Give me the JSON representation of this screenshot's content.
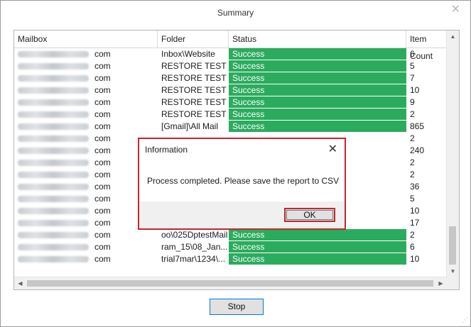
{
  "window": {
    "title": "Summary",
    "close_glyph": "✕",
    "size_grip": "⋰"
  },
  "table": {
    "columns": [
      "Mailbox",
      "Folder",
      "Status",
      "Item Count"
    ],
    "rows": [
      {
        "mailbox": "com",
        "folder": "Inbox\\Website",
        "status": "Success",
        "count": "6"
      },
      {
        "mailbox": "com",
        "folder": "RESTORE TEST ...",
        "status": "Success",
        "count": "5"
      },
      {
        "mailbox": "com",
        "folder": "RESTORE TEST ...",
        "status": "Success",
        "count": "7"
      },
      {
        "mailbox": "com",
        "folder": "RESTORE TEST ...",
        "status": "Success",
        "count": "10"
      },
      {
        "mailbox": "com",
        "folder": "RESTORE TEST ...",
        "status": "Success",
        "count": "9"
      },
      {
        "mailbox": "com",
        "folder": "RESTORE TEST ...",
        "status": "Success",
        "count": "2"
      },
      {
        "mailbox": "com",
        "folder": "[Gmail]\\All Mail",
        "status": "Success",
        "count": "865"
      },
      {
        "mailbox": "com",
        "folder": "",
        "status": "",
        "count": "2"
      },
      {
        "mailbox": "com",
        "folder": "",
        "status": "",
        "count": "240"
      },
      {
        "mailbox": "com",
        "folder": "",
        "status": "",
        "count": "2"
      },
      {
        "mailbox": "com",
        "folder": "",
        "status": "",
        "count": "2"
      },
      {
        "mailbox": "com",
        "folder": "",
        "status": "",
        "count": "36"
      },
      {
        "mailbox": "com",
        "folder": "",
        "status": "",
        "count": "5"
      },
      {
        "mailbox": "com",
        "folder": "",
        "status": "",
        "count": "10"
      },
      {
        "mailbox": "com",
        "folder": "",
        "status": "",
        "count": "17"
      },
      {
        "mailbox": "com",
        "folder": "oo\\025DptestMail",
        "status": "Success",
        "count": "2"
      },
      {
        "mailbox": "com",
        "folder": "ram_15\\08_Jan...",
        "status": "Success",
        "count": "6"
      },
      {
        "mailbox": "com",
        "folder": "trial7mar\\1234\\...",
        "status": "Success",
        "count": "10"
      }
    ],
    "scroll_up": "▲",
    "scroll_down": "▼",
    "scroll_left": "◀",
    "scroll_right": "▶"
  },
  "dialog": {
    "title": "Information",
    "close_glyph": "✕",
    "message": "Process completed. Please save the report to CSV",
    "ok_label": "OK"
  },
  "footer": {
    "stop_label": "Stop"
  },
  "colors": {
    "success": "#2bab5e",
    "highlight": "#c4262e",
    "focus": "#0078d7"
  }
}
